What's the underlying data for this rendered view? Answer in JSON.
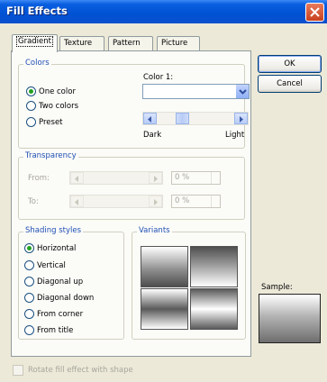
{
  "window": {
    "title": "Fill Effects"
  },
  "tabs": [
    {
      "label": "Gradient",
      "active": true
    },
    {
      "label": "Texture",
      "active": false
    },
    {
      "label": "Pattern",
      "active": false
    },
    {
      "label": "Picture",
      "active": false
    }
  ],
  "colors": {
    "title": "Colors",
    "options": [
      {
        "label": "One color",
        "checked": true
      },
      {
        "label": "Two colors",
        "checked": false
      },
      {
        "label": "Preset",
        "checked": false
      }
    ],
    "color1_label": "Color 1:",
    "color1_value": "",
    "dark_label": "Dark",
    "light_label": "Light"
  },
  "transparency": {
    "title": "Transparency",
    "from_label": "From:",
    "to_label": "To:",
    "from_value": "0 %",
    "to_value": "0 %"
  },
  "shading": {
    "title": "Shading styles",
    "options": [
      {
        "label": "Horizontal",
        "checked": true
      },
      {
        "label": "Vertical",
        "checked": false
      },
      {
        "label": "Diagonal up",
        "checked": false
      },
      {
        "label": "Diagonal down",
        "checked": false
      },
      {
        "label": "From corner",
        "checked": false
      },
      {
        "label": "From title",
        "checked": false
      }
    ]
  },
  "variants": {
    "title": "Variants"
  },
  "buttons": {
    "ok": "OK",
    "cancel": "Cancel"
  },
  "sample": {
    "label": "Sample:"
  },
  "rotate_checkbox": {
    "label": "Rotate fill effect with shape",
    "checked": false,
    "enabled": false
  },
  "colors_accent": {
    "titlebar": "#0052d4",
    "group_title": "#1f4fb4",
    "radio_on": "#21a121"
  }
}
